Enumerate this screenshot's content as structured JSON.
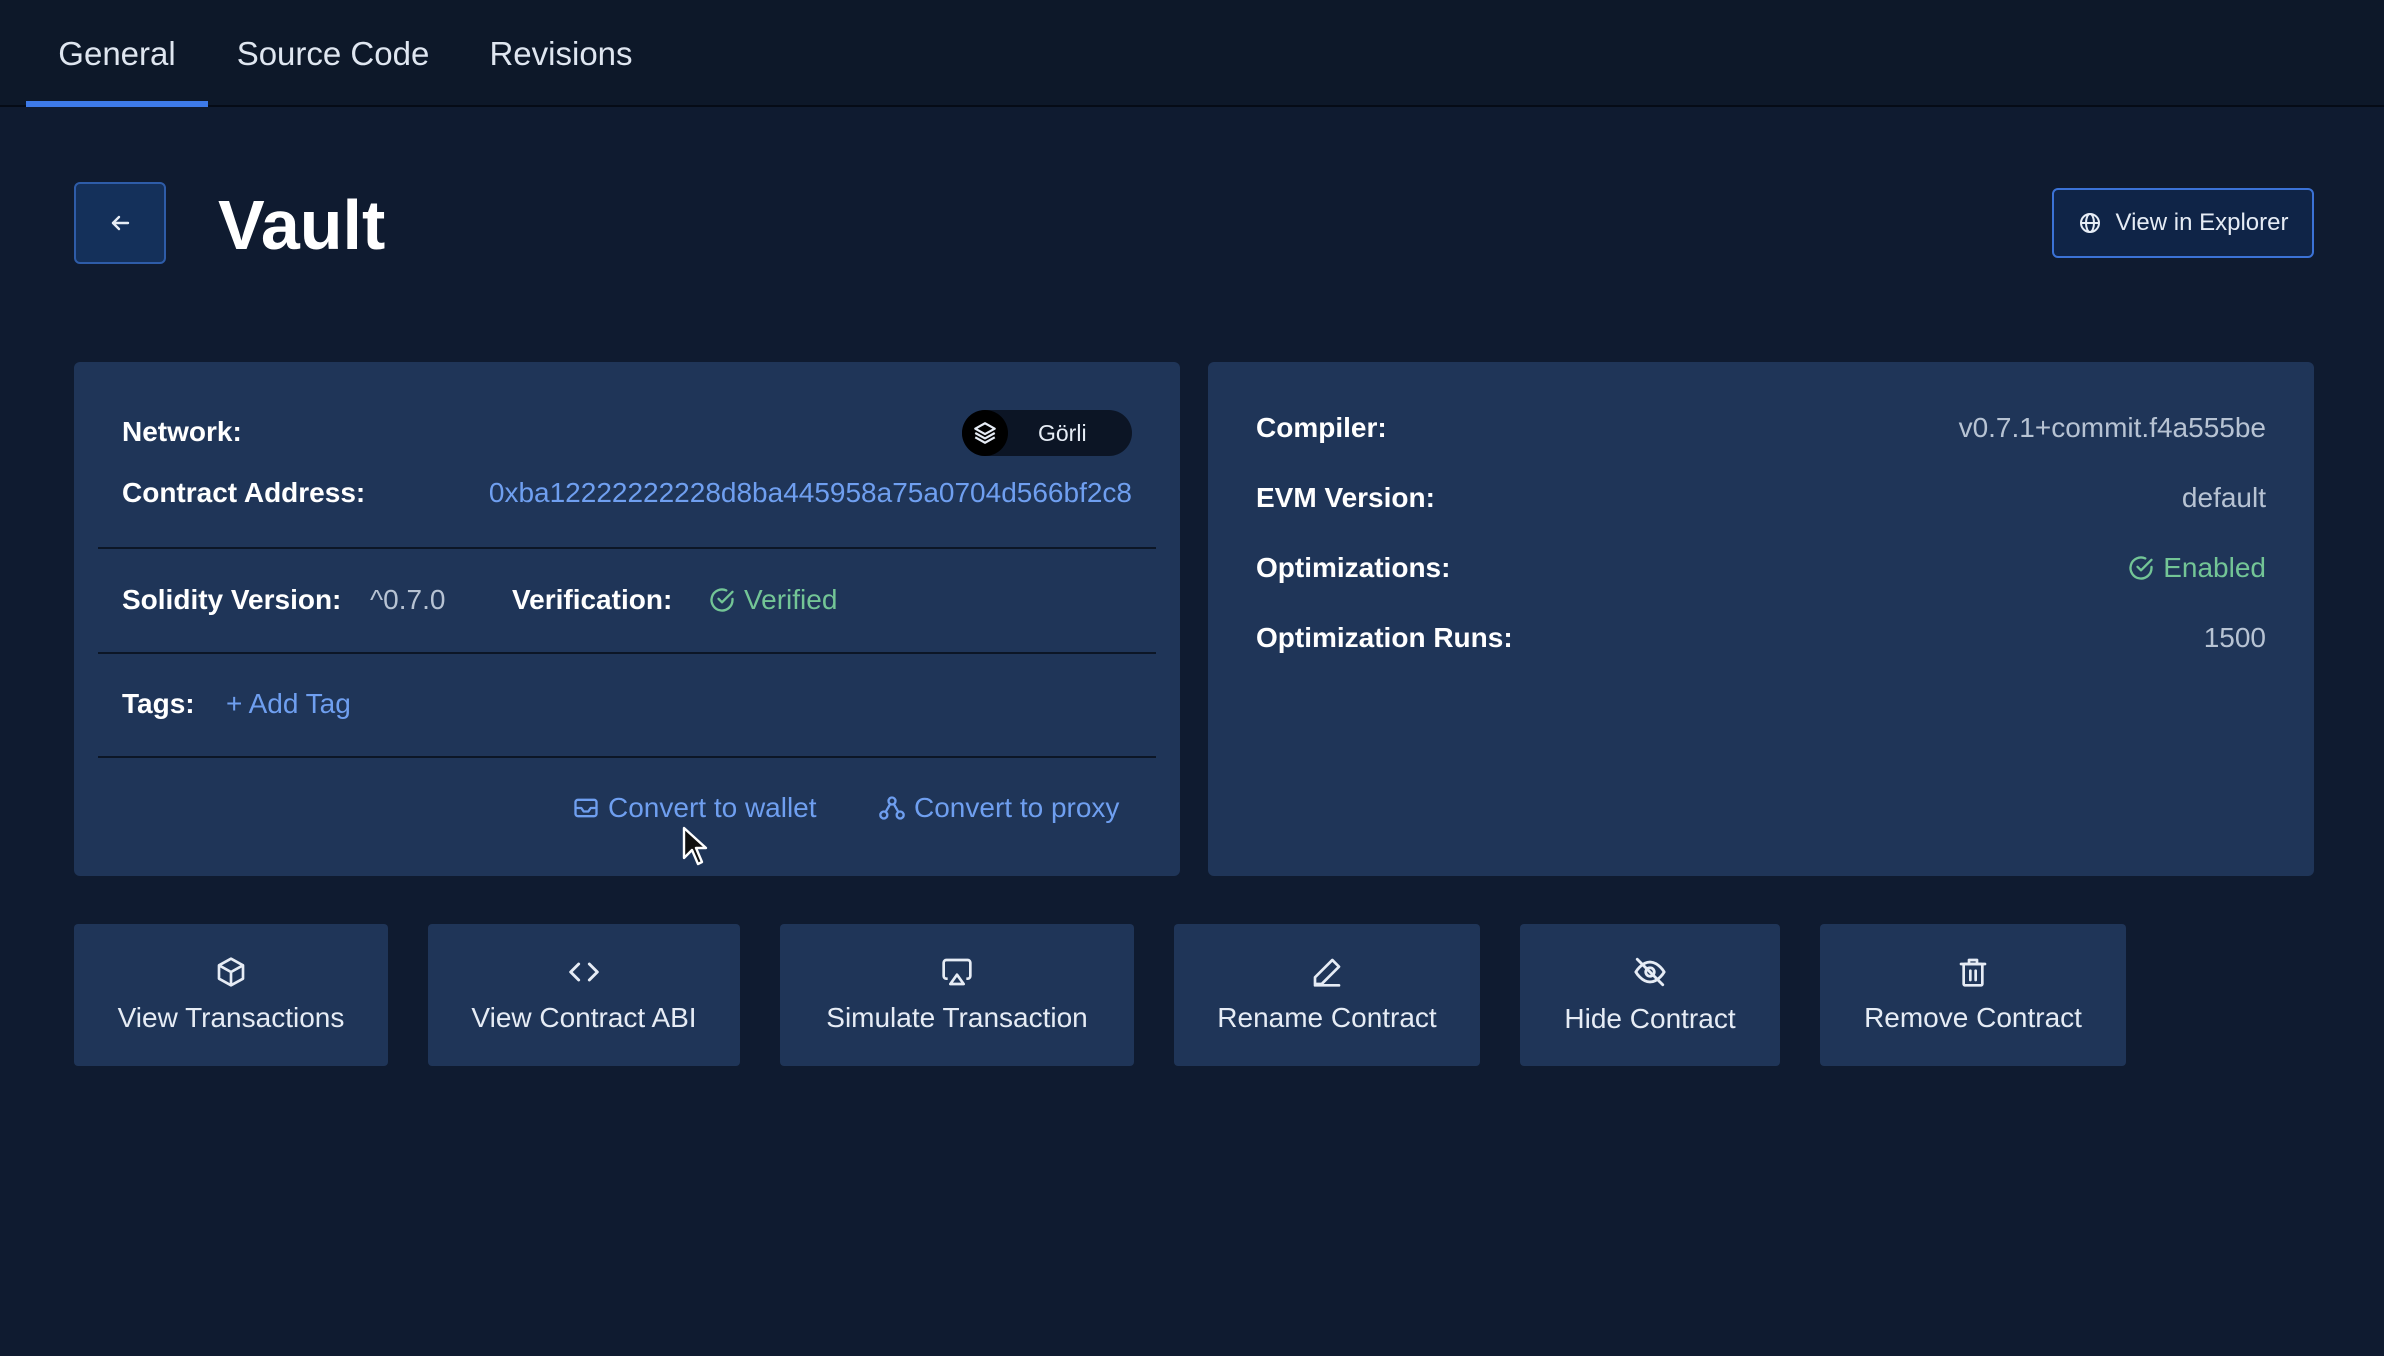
{
  "tabs": [
    {
      "label": "General",
      "active": true
    },
    {
      "label": "Source Code",
      "active": false
    },
    {
      "label": "Revisions",
      "active": false
    }
  ],
  "header": {
    "title": "Vault",
    "explorer_label": "View in Explorer"
  },
  "details": {
    "network_label": "Network:",
    "network_name": "Görli",
    "address_label": "Contract Address:",
    "address": "0xba12222222228d8ba445958a75a0704d566bf2c8",
    "solidity_label": "Solidity Version:",
    "solidity_version": "^0.7.0",
    "verification_label": "Verification:",
    "verification_status": "Verified",
    "tags_label": "Tags:",
    "add_tag": "+ Add Tag",
    "convert_wallet": "Convert to wallet",
    "convert_proxy": "Convert to proxy"
  },
  "compiler": {
    "compiler_label": "Compiler:",
    "compiler_value": "v0.7.1+commit.f4a555be",
    "evm_label": "EVM Version:",
    "evm_value": "default",
    "optimizations_label": "Optimizations:",
    "optimizations_value": "Enabled",
    "runs_label": "Optimization Runs:",
    "runs_value": "1500"
  },
  "actions": [
    {
      "label": "View Transactions",
      "icon": "cube-icon"
    },
    {
      "label": "View Contract ABI",
      "icon": "code-icon"
    },
    {
      "label": "Simulate Transaction",
      "icon": "airplay-icon"
    },
    {
      "label": "Rename Contract",
      "icon": "pencil-icon"
    },
    {
      "label": "Hide Contract",
      "icon": "eye-off-icon"
    },
    {
      "label": "Remove Contract",
      "icon": "trash-icon"
    }
  ],
  "colors": {
    "background": "#0f1b30",
    "card": "#1f3558",
    "accent": "#3d7ae8",
    "link": "#6f9ff0",
    "success": "#73c596"
  }
}
